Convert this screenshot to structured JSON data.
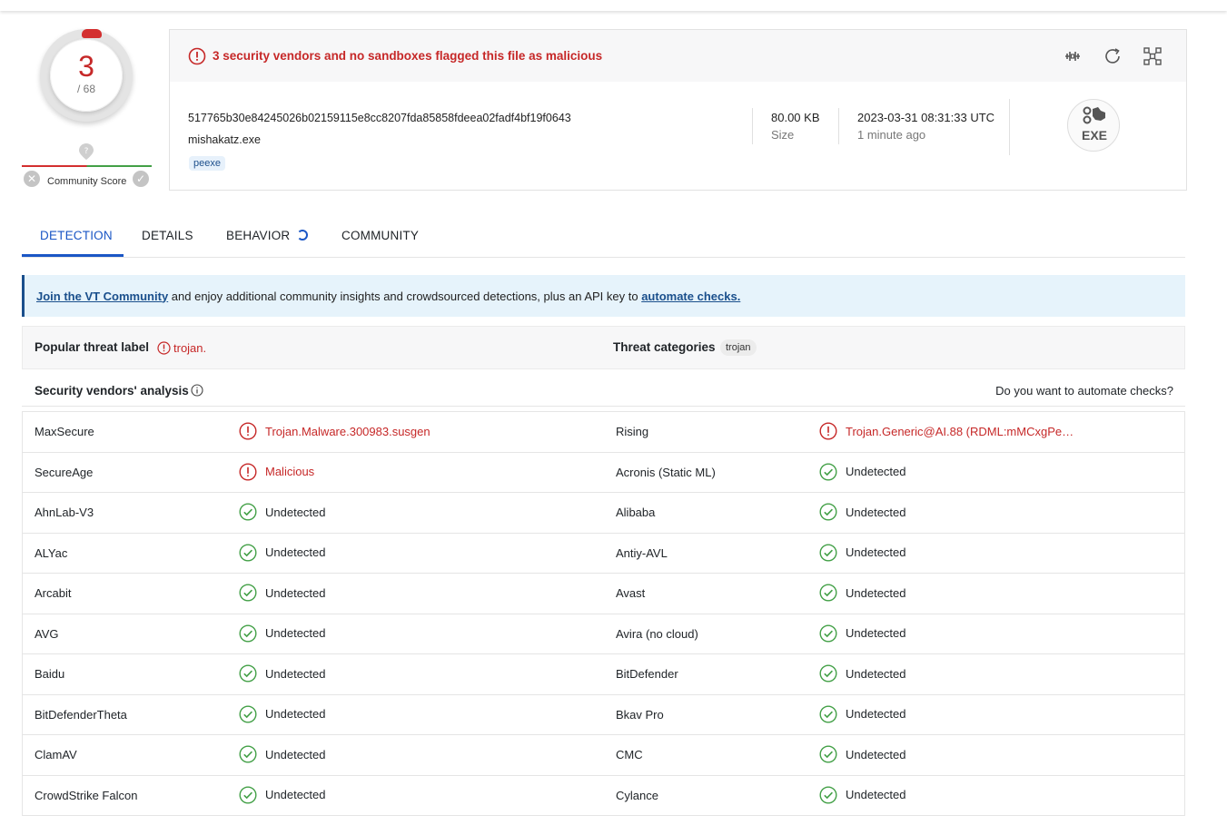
{
  "score": {
    "detections": "3",
    "total": "/ 68",
    "community_label": "Community Score"
  },
  "alert": {
    "text": "3 security vendors and no sandboxes flagged this file as malicious"
  },
  "file": {
    "hash": "517765b30e84245026b02159115e8cc8207fda85858fdeea02fadf4bf19f0643",
    "name": "mishakatz.exe",
    "tag": "peexe",
    "size_value": "80.00 KB",
    "size_label": "Size",
    "date_value": "2023-03-31 08:31:33 UTC",
    "date_label": "1 minute ago",
    "type_badge": "EXE"
  },
  "actions": {
    "icons": [
      "compare-icon",
      "reanalyze-icon",
      "graph-icon"
    ]
  },
  "tabs": [
    {
      "label": "DETECTION",
      "active": true
    },
    {
      "label": "DETAILS",
      "active": false
    },
    {
      "label": "BEHAVIOR",
      "active": false
    },
    {
      "label": "COMMUNITY",
      "active": false
    }
  ],
  "banner": {
    "link1": "Join the VT Community",
    "middle": " and enjoy additional community insights and crowdsourced detections, plus an API key to ",
    "link2": "automate checks."
  },
  "threat": {
    "popular_label": "Popular threat label",
    "popular_value": "trojan.",
    "categories_label": "Threat categories",
    "category": "trojan"
  },
  "analysis": {
    "title": "Security vendors' analysis",
    "automate_prompt": "Do you want to automate checks?"
  },
  "colors": {
    "malicious": "#c62828",
    "clean": "#43a047",
    "accent": "#1a56c5"
  },
  "vendors": [
    [
      {
        "name": "MaxSecure",
        "result": "Trojan.Malware.300983.susgen",
        "status": "malicious"
      },
      {
        "name": "Rising",
        "result": "Trojan.Generic@AI.88 (RDML:mMCxgPe…",
        "status": "malicious"
      }
    ],
    [
      {
        "name": "SecureAge",
        "result": "Malicious",
        "status": "malicious"
      },
      {
        "name": "Acronis (Static ML)",
        "result": "Undetected",
        "status": "clean"
      }
    ],
    [
      {
        "name": "AhnLab-V3",
        "result": "Undetected",
        "status": "clean"
      },
      {
        "name": "Alibaba",
        "result": "Undetected",
        "status": "clean"
      }
    ],
    [
      {
        "name": "ALYac",
        "result": "Undetected",
        "status": "clean"
      },
      {
        "name": "Antiy-AVL",
        "result": "Undetected",
        "status": "clean"
      }
    ],
    [
      {
        "name": "Arcabit",
        "result": "Undetected",
        "status": "clean"
      },
      {
        "name": "Avast",
        "result": "Undetected",
        "status": "clean"
      }
    ],
    [
      {
        "name": "AVG",
        "result": "Undetected",
        "status": "clean"
      },
      {
        "name": "Avira (no cloud)",
        "result": "Undetected",
        "status": "clean"
      }
    ],
    [
      {
        "name": "Baidu",
        "result": "Undetected",
        "status": "clean"
      },
      {
        "name": "BitDefender",
        "result": "Undetected",
        "status": "clean"
      }
    ],
    [
      {
        "name": "BitDefenderTheta",
        "result": "Undetected",
        "status": "clean"
      },
      {
        "name": "Bkav Pro",
        "result": "Undetected",
        "status": "clean"
      }
    ],
    [
      {
        "name": "ClamAV",
        "result": "Undetected",
        "status": "clean"
      },
      {
        "name": "CMC",
        "result": "Undetected",
        "status": "clean"
      }
    ],
    [
      {
        "name": "CrowdStrike Falcon",
        "result": "Undetected",
        "status": "clean"
      },
      {
        "name": "Cylance",
        "result": "Undetected",
        "status": "clean"
      }
    ]
  ]
}
